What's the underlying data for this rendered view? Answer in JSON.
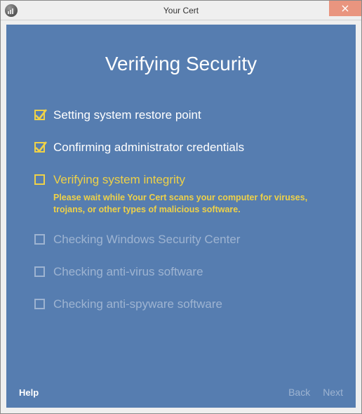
{
  "window": {
    "title": "Your Cert"
  },
  "page": {
    "title": "Verifying Security"
  },
  "steps": [
    {
      "label": "Setting system restore point",
      "state": "done"
    },
    {
      "label": "Confirming administrator credentials",
      "state": "done"
    },
    {
      "label": "Verifying system integrity",
      "state": "active",
      "desc": "Please wait while Your Cert scans your computer for viruses, trojans, or other types of malicious software."
    },
    {
      "label": "Checking Windows Security Center",
      "state": "pending"
    },
    {
      "label": "Checking anti-virus software",
      "state": "pending"
    },
    {
      "label": "Checking anti-spyware software",
      "state": "pending"
    }
  ],
  "footer": {
    "help": "Help",
    "back": "Back",
    "next": "Next"
  }
}
